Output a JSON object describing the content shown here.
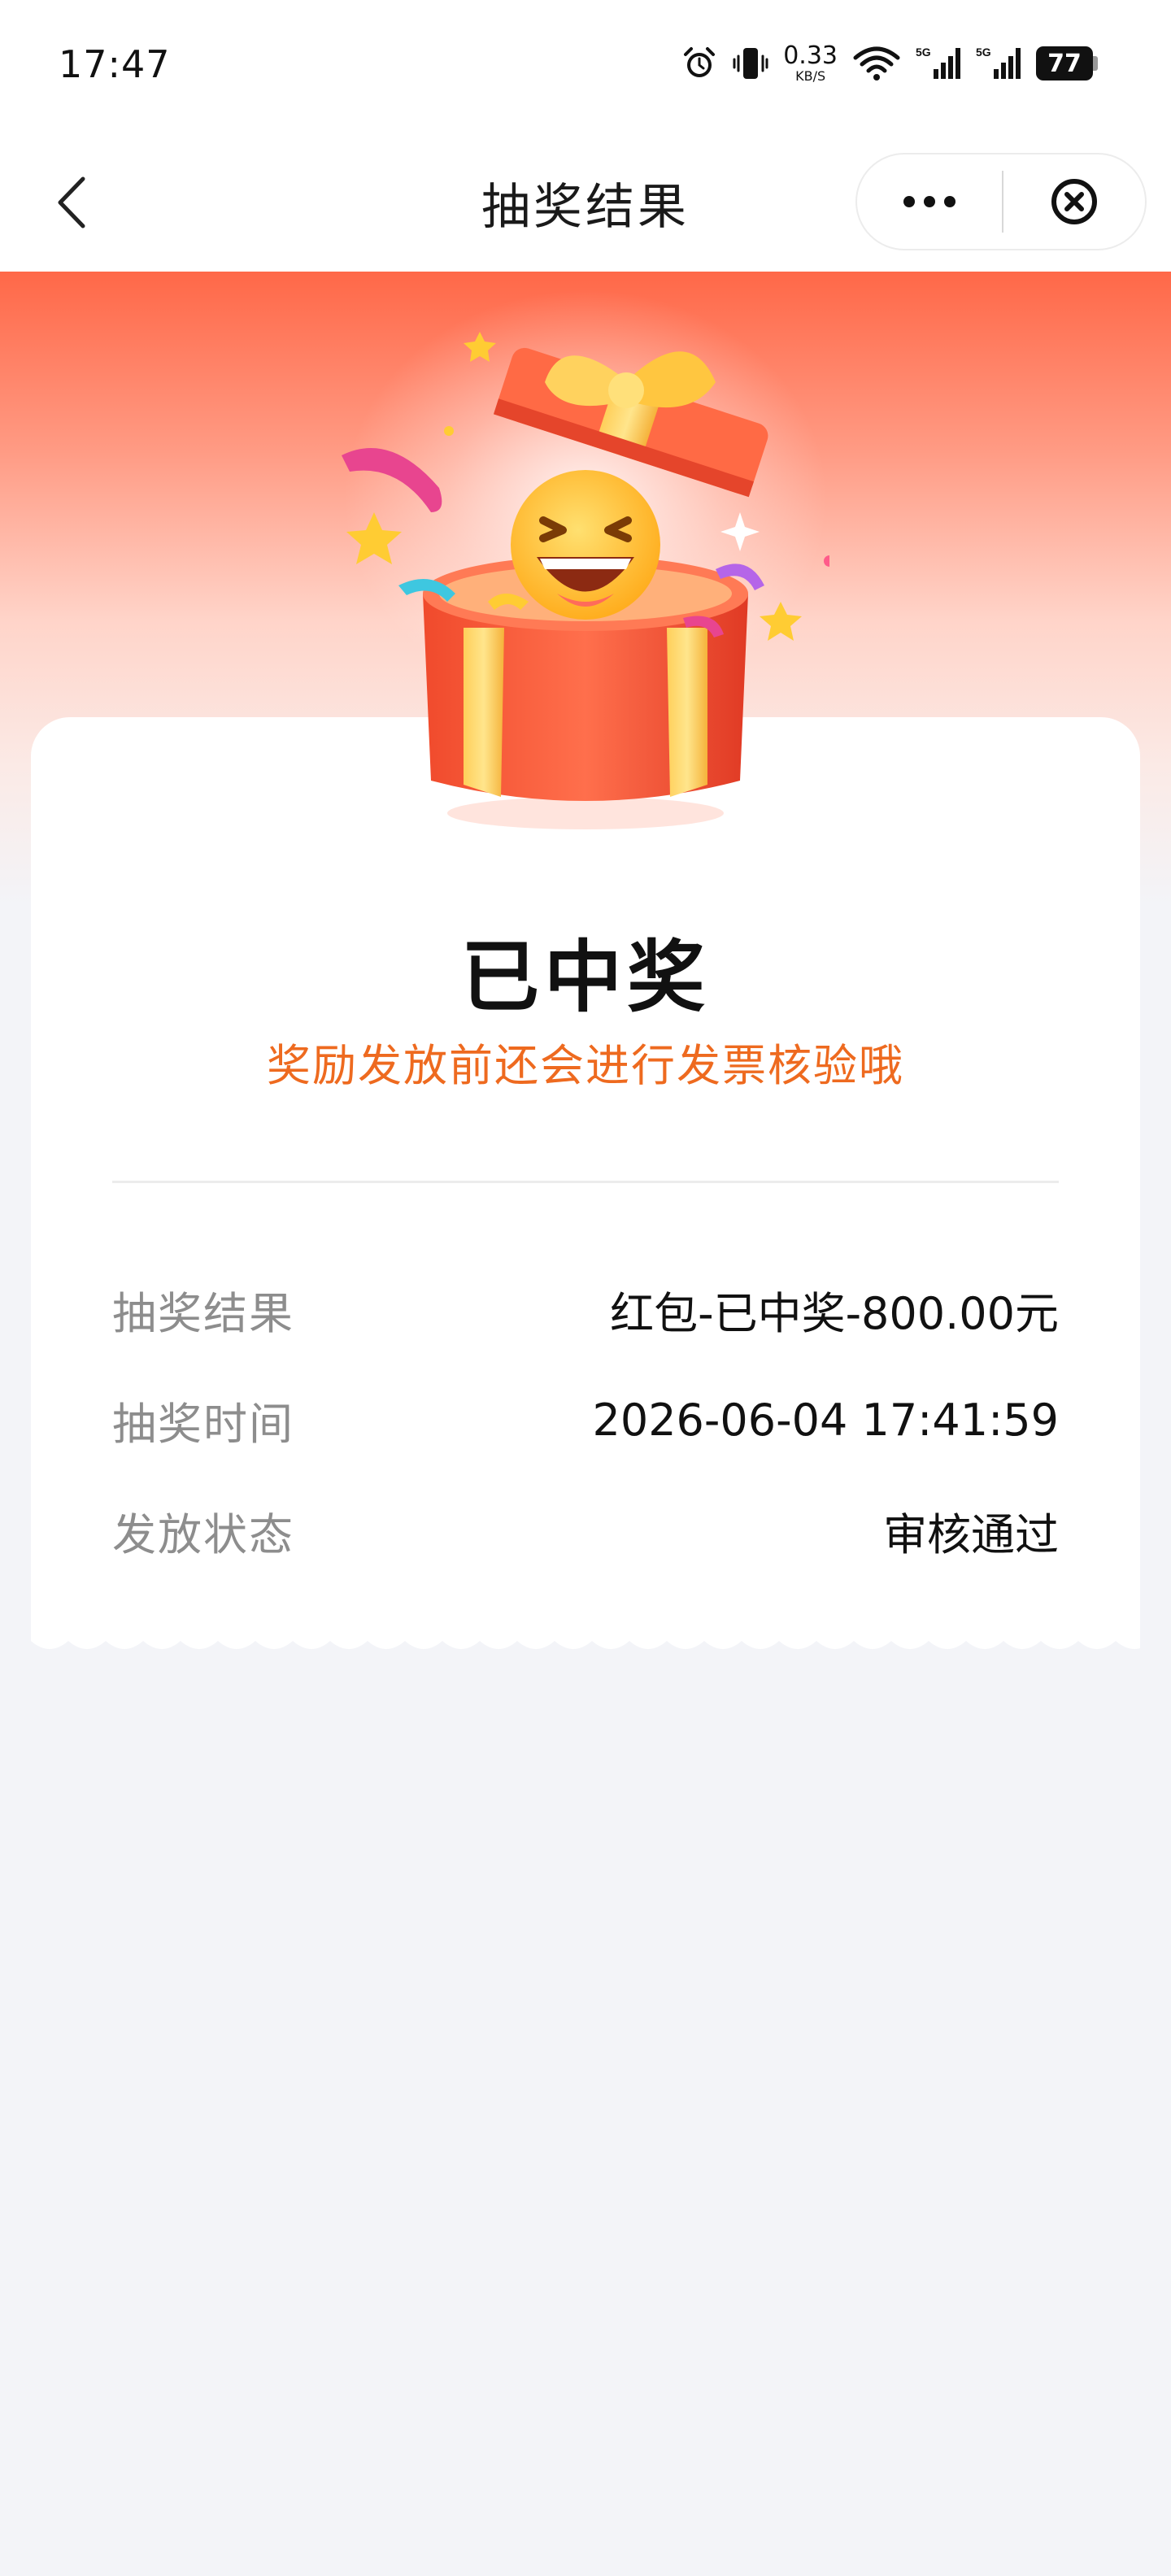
{
  "status_bar": {
    "time": "17:47",
    "network_speed_value": "0.33",
    "network_speed_unit": "KB/S",
    "signal_1_label": "5G",
    "signal_2_label": "5G",
    "battery_level": "77",
    "icons": [
      "alarm-icon",
      "vibrate-icon",
      "wifi-icon",
      "signal-5g-icon",
      "signal-5g-icon",
      "battery-icon"
    ]
  },
  "nav": {
    "title": "抽奖结果",
    "back_icon": "chevron-left-icon",
    "more_icon": "more-dots-icon",
    "close_icon": "close-circle-icon"
  },
  "result": {
    "title": "已中奖",
    "subtitle": "奖励发放前还会进行发票核验哦"
  },
  "details": [
    {
      "label": "抽奖结果",
      "value": "红包-已中奖-800.00元"
    },
    {
      "label": "抽奖时间",
      "value": "2026-06-04 17:41:59"
    },
    {
      "label": "发放状态",
      "value": "审核通过"
    }
  ],
  "colors": {
    "accent_orange": "#ee6a1f",
    "hero_red": "#ff6848",
    "page_background": "#f3f4f8"
  }
}
